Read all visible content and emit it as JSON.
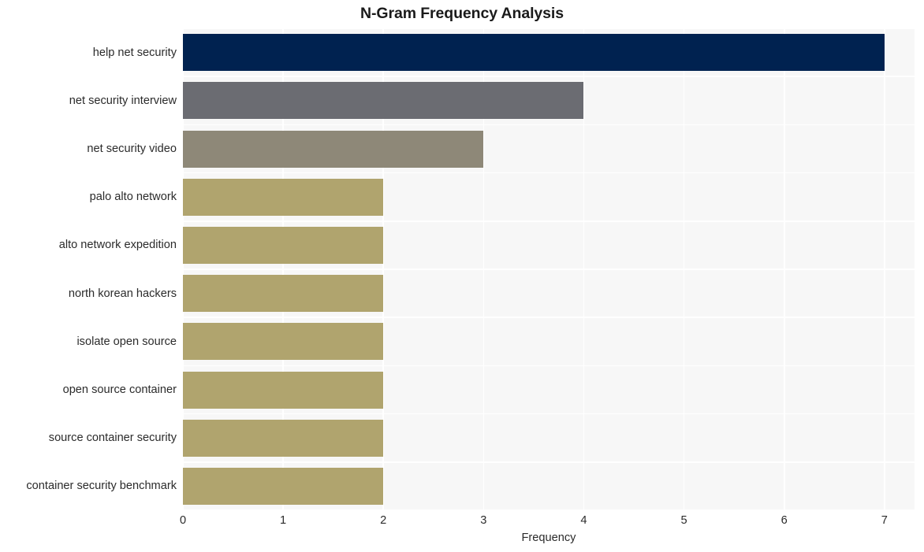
{
  "chart_data": {
    "type": "bar",
    "orientation": "horizontal",
    "title": "N-Gram Frequency Analysis",
    "xlabel": "Frequency",
    "ylabel": "",
    "categories": [
      "help net security",
      "net security interview",
      "net security video",
      "palo alto network",
      "alto network expedition",
      "north korean hackers",
      "isolate open source",
      "open source container",
      "source container security",
      "container security benchmark"
    ],
    "values": [
      7,
      4,
      3,
      2,
      2,
      2,
      2,
      2,
      2,
      2
    ],
    "bar_colors": [
      "#002250",
      "#6b6c72",
      "#8e8878",
      "#b0a46e",
      "#b0a46e",
      "#b0a46e",
      "#b0a46e",
      "#b0a46e",
      "#b0a46e",
      "#b0a46e"
    ],
    "xlim": [
      0,
      7.3
    ],
    "xticks": [
      "0",
      "1",
      "2",
      "3",
      "4",
      "5",
      "6",
      "7"
    ],
    "xtick_values": [
      0,
      1,
      2,
      3,
      4,
      5,
      6,
      7
    ],
    "grid": true,
    "grid_color": "#ffffff",
    "plot_background": "#f7f7f7",
    "figure_background": "#ffffff",
    "legend": null
  }
}
